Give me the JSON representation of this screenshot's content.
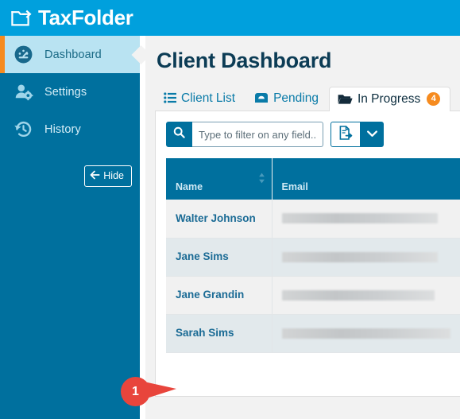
{
  "brand": {
    "title": "TaxFolder",
    "logo_icon": "folder-arrow-icon",
    "bar_color": "#00a0dd"
  },
  "sidebar": {
    "background_color": "#00709e",
    "active_background_color": "#b9e3f2",
    "accent_color": "#f68b1f",
    "items": [
      {
        "label": "Dashboard",
        "icon": "dashboard-gauge-icon",
        "active": true
      },
      {
        "label": "Settings",
        "icon": "user-gear-icon",
        "active": false
      },
      {
        "label": "History",
        "icon": "clock-rewind-icon",
        "active": false
      }
    ],
    "hide_button": {
      "label": "Hide",
      "icon": "arrow-left-icon"
    }
  },
  "main": {
    "page_title": "Client Dashboard",
    "tabs": [
      {
        "label": "Client List",
        "icon": "list-icon",
        "active": false,
        "badge": null
      },
      {
        "label": "Pending",
        "icon": "inbox-icon",
        "active": false,
        "badge": null
      },
      {
        "label": "In Progress",
        "icon": "open-folder-icon",
        "active": true,
        "badge": "4"
      }
    ],
    "toolbar": {
      "search_icon": "magnifier-icon",
      "search_value": "",
      "search_placeholder": "Type to filter on any field...",
      "export_icon": "document-export-icon",
      "caret_icon": "chevron-down-icon"
    },
    "table": {
      "columns": [
        {
          "label": "Name",
          "sort_icon": "sort-icon"
        },
        {
          "label": "Email",
          "sort_icon": "sort-icon"
        }
      ],
      "rows": [
        {
          "name": "Walter Johnson",
          "email": "",
          "email_redacted": true,
          "redact_width": 196
        },
        {
          "name": "Jane Sims",
          "email": "",
          "email_redacted": true,
          "redact_width": 196
        },
        {
          "name": "Jane Grandin",
          "email": "",
          "email_redacted": true,
          "redact_width": 192
        },
        {
          "name": "Sarah Sims",
          "email": "",
          "email_redacted": true,
          "redact_width": 212
        }
      ]
    }
  },
  "annotation": {
    "number": "1",
    "color": "#e8453c",
    "points_to": "Sarah Sims"
  }
}
